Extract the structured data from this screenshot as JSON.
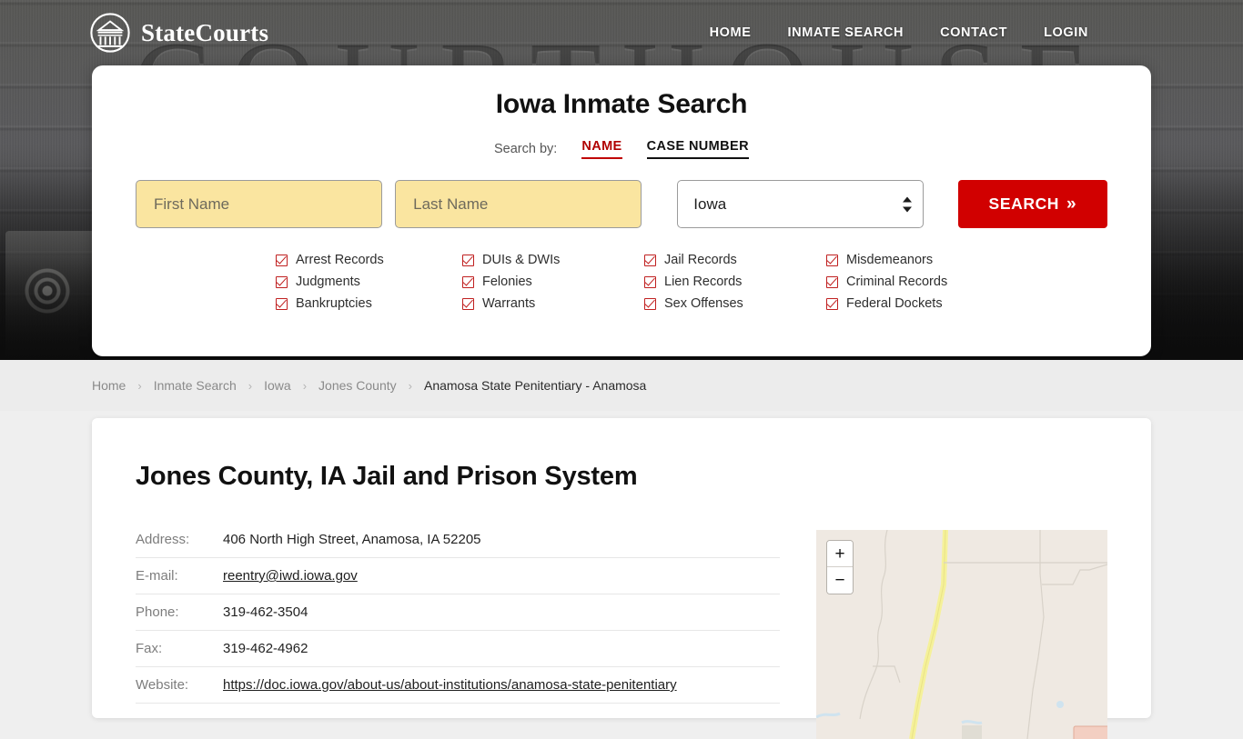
{
  "header": {
    "brand_name": "StateCourts",
    "logo_icon": "courthouse-circle-icon",
    "background_word": "COURTHOUSE",
    "nav": [
      {
        "label": "HOME"
      },
      {
        "label": "INMATE SEARCH"
      },
      {
        "label": "CONTACT"
      },
      {
        "label": "LOGIN"
      }
    ]
  },
  "search": {
    "title": "Iowa Inmate Search",
    "search_by_label": "Search by:",
    "tabs": [
      {
        "label": "NAME",
        "active": true,
        "color": "#b00000"
      },
      {
        "label": "CASE NUMBER",
        "active": false,
        "color": "#111111"
      }
    ],
    "first_name_placeholder": "First Name",
    "first_name_value": "",
    "last_name_placeholder": "Last Name",
    "last_name_value": "",
    "state_selected": "Iowa",
    "state_options": [
      "Iowa"
    ],
    "submit_label": "SEARCH",
    "submit_chevron": "»",
    "input_background": "#fae5a0",
    "submit_color": "#d10000",
    "features": [
      "Arrest Records",
      "DUIs & DWIs",
      "Jail Records",
      "Misdemeanors",
      "Judgments",
      "Felonies",
      "Lien Records",
      "Criminal Records",
      "Bankruptcies",
      "Warrants",
      "Sex Offenses",
      "Federal Dockets"
    ]
  },
  "breadcrumb": {
    "separator": "›",
    "items": [
      {
        "label": "Home",
        "current": false
      },
      {
        "label": "Inmate Search",
        "current": false
      },
      {
        "label": "Iowa",
        "current": false
      },
      {
        "label": "Jones County",
        "current": false
      },
      {
        "label": "Anamosa State Penitentiary - Anamosa",
        "current": true
      }
    ]
  },
  "main": {
    "page_title": "Jones County, IA Jail and Prison System",
    "details": [
      {
        "label": "Address:",
        "value": "406 North High Street, Anamosa, IA 52205",
        "link": false
      },
      {
        "label": "E-mail:",
        "value": "reentry@iwd.iowa.gov",
        "link": true
      },
      {
        "label": "Phone:",
        "value": "319-462-3504",
        "link": false
      },
      {
        "label": "Fax:",
        "value": "319-462-4962",
        "link": false
      },
      {
        "label": "Website:",
        "value": "https://doc.iowa.gov/about-us/about-institutions/anamosa-state-penitentiary",
        "link": true
      }
    ]
  },
  "map": {
    "zoom_in_label": "+",
    "zoom_out_label": "−",
    "background_color": "#efe9e2",
    "highway_color": "#f5f19a"
  }
}
